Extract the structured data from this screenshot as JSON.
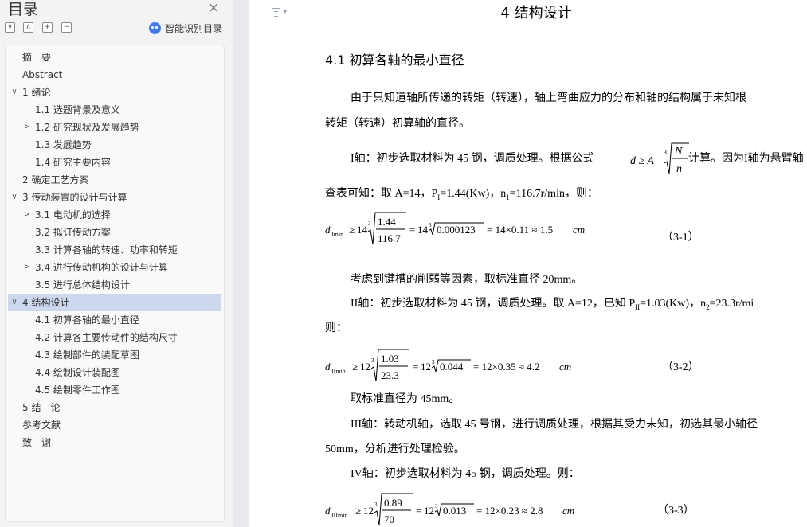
{
  "toc": {
    "title": "目录",
    "close_glyph": "×",
    "tools": [
      "∨",
      "∧",
      "+",
      "−"
    ],
    "smart_label": "智能识别目录",
    "items": [
      {
        "label": "摘　要",
        "level": 0,
        "arrow": ""
      },
      {
        "label": "Abstract",
        "level": 0,
        "arrow": ""
      },
      {
        "label": "1 绪论",
        "level": 0,
        "arrow": "∨"
      },
      {
        "label": "1.1 选题背景及意义",
        "level": 1,
        "arrow": ""
      },
      {
        "label": "1.2 研究现状及发展趋势",
        "level": 1,
        "arrow": ">"
      },
      {
        "label": "1.3 发展趋势",
        "level": 1,
        "arrow": ""
      },
      {
        "label": "1.4 研究主要内容",
        "level": 1,
        "arrow": ""
      },
      {
        "label": "2 确定工艺方案",
        "level": 0,
        "arrow": ""
      },
      {
        "label": "3 传动装置的设计与计算",
        "level": 0,
        "arrow": "∨"
      },
      {
        "label": "3.1 电动机的选择",
        "level": 1,
        "arrow": ">"
      },
      {
        "label": "3.2 拟订传动方案",
        "level": 1,
        "arrow": ""
      },
      {
        "label": "3.3 计算各轴的转速、功率和转矩",
        "level": 1,
        "arrow": ""
      },
      {
        "label": "3.4 进行传动机构的设计与计算",
        "level": 1,
        "arrow": ">"
      },
      {
        "label": "3.5 进行总体结构设计",
        "level": 1,
        "arrow": ""
      },
      {
        "label": "4 结构设计",
        "level": 0,
        "arrow": "∨",
        "selected": true
      },
      {
        "label": "4.1 初算各轴的最小直径",
        "level": 1,
        "arrow": ""
      },
      {
        "label": "4.2 计算各主要传动件的结构尺寸",
        "level": 1,
        "arrow": ""
      },
      {
        "label": "4.3 绘制部件的装配草图",
        "level": 1,
        "arrow": ""
      },
      {
        "label": "4.4 绘制设计装配图",
        "level": 1,
        "arrow": ""
      },
      {
        "label": "4.5 绘制零件工作图",
        "level": 1,
        "arrow": ""
      },
      {
        "label": "5 结　论",
        "level": 0,
        "arrow": ""
      },
      {
        "label": "参考文献",
        "level": 0,
        "arrow": ""
      },
      {
        "label": "致　谢",
        "level": 0,
        "arrow": ""
      }
    ]
  },
  "doc": {
    "chapter_title": "4 结构设计",
    "section_title": "4.1 初算各轴的最小直径",
    "p1_line1": "由于只知道轴所传递的转矩（转速），轴上弯曲应力的分布和轴的结构属于未知根",
    "p1_line2": "转矩（转速）初算轴的直径。",
    "p2_a": "I轴：初步选取材料为 45 钢，调质处理。根据公式",
    "p2_b": "计算。因为I轴为悬臂轴",
    "p3": "查表可知：取 A=14，P",
    "p3_sub": "I",
    "p3_b": "=1.44(Kw)，n",
    "p3_sub2": "1",
    "p3_c": "=116.7r/min，则：",
    "formula_d": "d ≥ A",
    "formula_N": "N",
    "formula_n": "n",
    "eq1": {
      "sub": "Imin",
      "coef": "14",
      "num": "1.44",
      "den": "116.7",
      "rad": "0.000123",
      "rhs": "= 14×0.11 ≈ 1.5",
      "unit": "cm",
      "no": "（3-1）"
    },
    "p4": "考虑到键槽的削弱等因素，取标准直径 20mm。",
    "p5": "II轴：初步选取材料为 45 钢，调质处理。取 A=12，已知 P",
    "p5_sub": "II",
    "p5_b": "=1.03(Kw)，n",
    "p5_sub2": "2",
    "p5_c": "=23.3r/mi",
    "p5_line2": "则：",
    "eq2": {
      "sub": "IImin",
      "coef": "12",
      "num": "1.03",
      "den": "23.3",
      "rad": "0.044",
      "rhs": "= 12×0.35 ≈ 4.2",
      "unit": "cm",
      "no": "（3-2）"
    },
    "p6": "取标准直径为 45mm。",
    "p7_line1": "III轴：转动机轴，选取 45 号钢，进行调质处理，根据其受力未知，初选其最小轴径",
    "p7_line2": "50mm，分析进行处理检验。",
    "p8": "IV轴：初步选取材料为 45 钢，调质处理。则：",
    "eq3": {
      "sub": "IIImin",
      "coef": "12",
      "num": "0.89",
      "den": "70",
      "rad": "0.013",
      "rhs": "= 12×0.23 ≈ 2.8",
      "unit": "cm",
      "no": "（3-3）"
    },
    "cube_index": "3",
    "geq": "≥"
  }
}
